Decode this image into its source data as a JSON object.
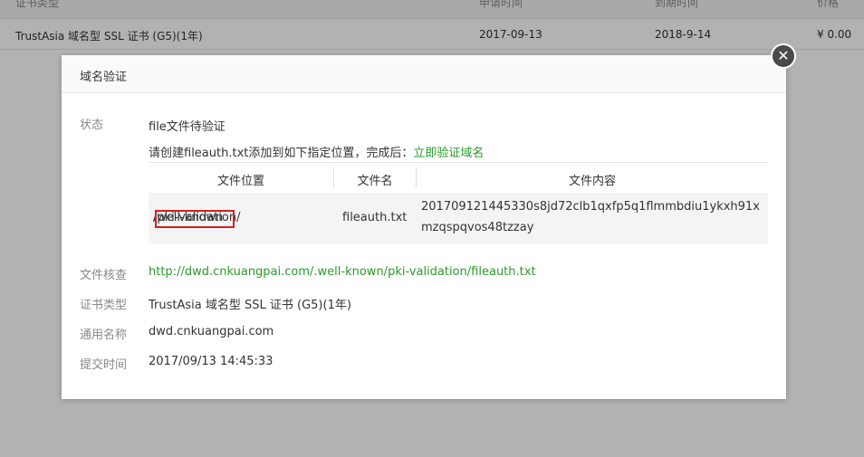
{
  "background_table": {
    "headers": [
      "证书类型",
      "申请时间",
      "到期时间",
      "价格"
    ],
    "row": [
      "TrustAsia 域名型 SSL 证书 (G5)(1年)",
      "2017-09-13",
      "2018-9-14",
      "¥ 0.00"
    ]
  },
  "modal": {
    "title": "域名验证",
    "close_glyph": "✕",
    "status_label": "状态",
    "status_value": "file文件待验证",
    "instruction_prefix": "请创建fileauth.txt添加到如下指定位置，完成后：",
    "instruction_link": "立即验证域名",
    "file_table": {
      "headers": [
        "文件位置",
        "文件名",
        "文件内容"
      ],
      "location_prefix": "/",
      "location_highlight": ".well-known",
      "location_suffix": "/pki-validation/",
      "filename": "fileauth.txt",
      "content_line1": "201709121445330s8jd72clb1qxfp5q1flmmbdiu1ykxh91x",
      "content_line2": "mzqspqvos48tzzay"
    },
    "fields": [
      {
        "label": "文件核查",
        "value": "http://dwd.cnkuangpai.com/.well-known/pki-validation/fileauth.txt"
      },
      {
        "label": "证书类型",
        "value": "TrustAsia 域名型 SSL 证书 (G5)(1年)"
      },
      {
        "label": "通用名称",
        "value": "dwd.cnkuangpai.com"
      },
      {
        "label": "提交时间",
        "value": "2017/09/13 14:45:33"
      }
    ]
  },
  "colors": {
    "link_green": "#2a9a2a",
    "highlight_red": "#d32222"
  }
}
